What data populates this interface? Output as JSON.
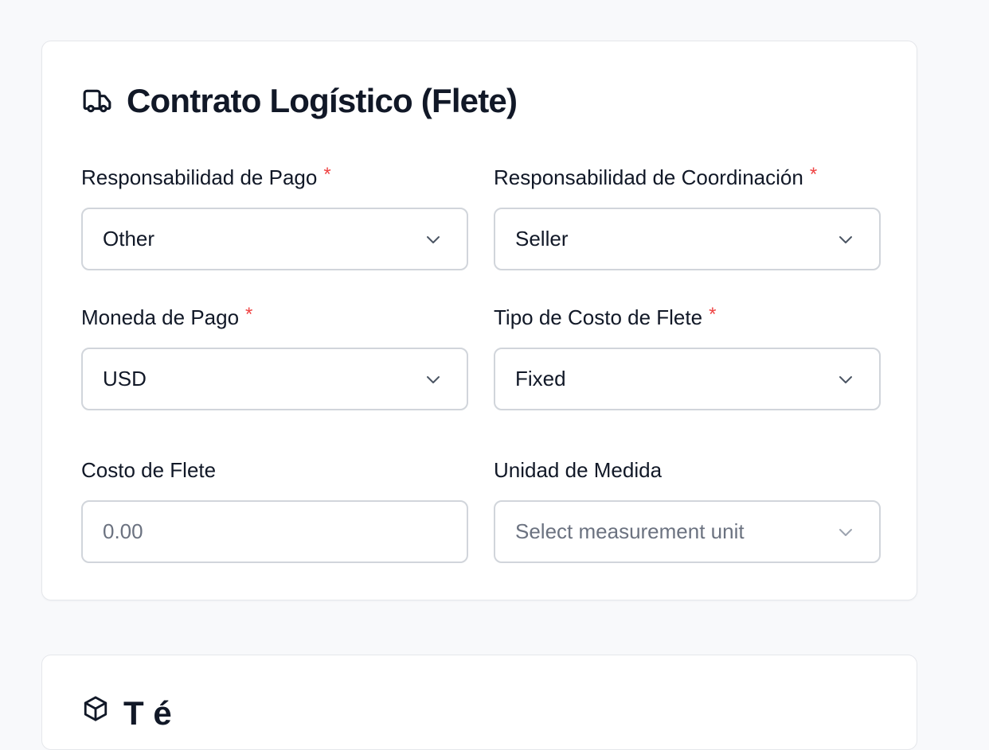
{
  "section": {
    "title": "Contrato Logístico (Flete)",
    "icon": "truck-icon"
  },
  "fields": {
    "payment_responsibility": {
      "label": "Responsabilidad de Pago",
      "required_mark": "*",
      "value": "Other"
    },
    "coordination_responsibility": {
      "label": "Responsabilidad de Coordinación",
      "required_mark": "*",
      "value": "Seller"
    },
    "payment_currency": {
      "label": "Moneda de Pago",
      "required_mark": "*",
      "value": "USD"
    },
    "freight_cost_type": {
      "label": "Tipo de Costo de Flete",
      "required_mark": "*",
      "value": "Fixed"
    },
    "freight_cost": {
      "label": "Costo de Flete",
      "placeholder": "0.00"
    },
    "unit_of_measure": {
      "label": "Unidad de Medida",
      "placeholder": "Select measurement unit"
    }
  },
  "next_section": {
    "icon": "package-icon",
    "title_partial": "T  é"
  },
  "colors": {
    "required": "#ef4444",
    "text": "#111827",
    "border": "#d1d5db",
    "placeholder": "#6b7280",
    "page_bg": "#f8f9fb"
  }
}
